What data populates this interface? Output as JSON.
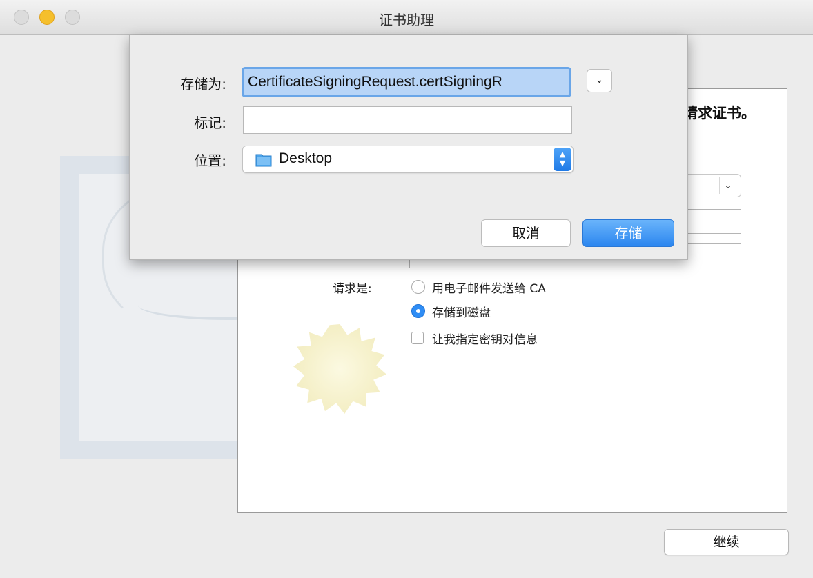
{
  "window": {
    "title": "证书助理"
  },
  "background_form": {
    "intro_text_fragment": "请求证书。",
    "request_label": "请求是:",
    "options": [
      {
        "label": "用电子邮件发送给 CA",
        "selected": false
      },
      {
        "label": "存储到磁盘",
        "selected": true
      }
    ],
    "specify_key_pair_label": "让我指定密钥对信息",
    "specify_key_pair_checked": false,
    "continue_label": "继续"
  },
  "save_sheet": {
    "save_as_label": "存储为:",
    "save_as_value": "CertificateSigningRequest.certSigningR",
    "tags_label": "标记:",
    "tags_value": "",
    "location_label": "位置:",
    "location_value": "Desktop",
    "cancel_label": "取消",
    "save_label": "存储"
  },
  "icons": {
    "expand": "chevron-down-icon",
    "folder": "folder-icon",
    "stepper": "up-down-stepper-icon"
  },
  "colors": {
    "accent": "#2b86ef",
    "selection": "#b8d5f7",
    "minimize": "#f5bf2c"
  }
}
